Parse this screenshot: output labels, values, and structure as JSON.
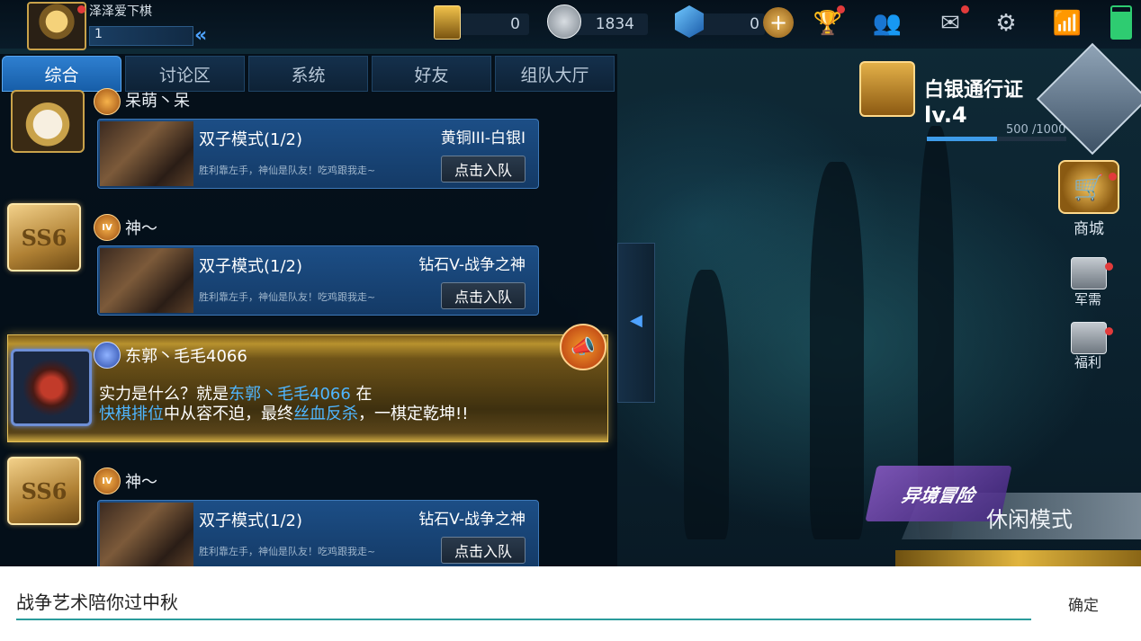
{
  "topbar": {
    "player_name": "泽泽爱下棋",
    "level": "1",
    "resources": [
      {
        "name": "card",
        "value": "0"
      },
      {
        "name": "coin",
        "value": "1834"
      },
      {
        "name": "diamond",
        "value": "0"
      }
    ],
    "icons": [
      "card-icon",
      "coin-icon",
      "diamond-icon",
      "add-icon",
      "trophy-icon",
      "friends-icon",
      "mail-icon",
      "gear-icon",
      "wifi-icon",
      "battery-icon"
    ]
  },
  "tabs": [
    {
      "label": "综合",
      "active": true
    },
    {
      "label": "讨论区",
      "active": false
    },
    {
      "label": "系统",
      "active": false
    },
    {
      "label": "好友",
      "active": false
    },
    {
      "label": "组队大厅",
      "active": false
    }
  ],
  "messages": [
    {
      "username": "呆萌丶呆",
      "card": {
        "title": "双子模式(1/2)",
        "rank": "黄铜III-白银I",
        "sub": "胜利靠左手，神仙是队友！吃鸡跟我走~",
        "button": "点击入队"
      }
    },
    {
      "username": "神～",
      "avatar_text": "SS6",
      "badge": "IV",
      "card": {
        "title": "双子模式(1/2)",
        "rank": "钻石V-战争之神",
        "sub": "胜利靠左手，神仙是队友！吃鸡跟我走~",
        "button": "点击入队"
      }
    },
    {
      "username": "神～",
      "avatar_text": "SS6",
      "badge": "IV",
      "card": {
        "title": "双子模式(1/2)",
        "rank": "钻石V-战争之神",
        "sub": "胜利靠左手，神仙是队友！吃鸡跟我走~",
        "button": "点击入队"
      }
    }
  ],
  "broadcast": {
    "username": "东郭丶毛毛4066",
    "line1_a": "实力是什么？就是",
    "line1_name": "东郭丶毛毛4066",
    "line1_b": " 在",
    "line2_mode": "快棋排位",
    "line2_a": "中从容不迫，最终",
    "line2_hl": "丝血反杀",
    "line2_b": "，一棋定乾坤!!"
  },
  "pass": {
    "title": "白银通行证",
    "level": "lv.4",
    "progress": "500 /1000",
    "progress_fraction": 0.5
  },
  "side": {
    "shop": "商城",
    "supply": "军需",
    "welfare": "福利"
  },
  "mode": {
    "event_logo": "异境冒险",
    "label": "休闲模式"
  },
  "input": {
    "value": "战争艺术陪你过中秋",
    "confirm": "确定"
  }
}
